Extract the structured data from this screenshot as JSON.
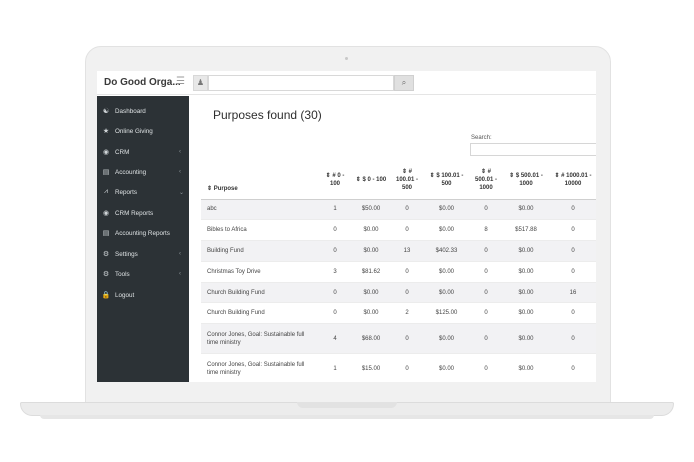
{
  "brand": {
    "name": "Do Good Orga...",
    "menu_icon": "hamburger-icon"
  },
  "topbar": {
    "user_icon": "user-icon",
    "search_icon": "search-icon",
    "search_glyph": "⌕",
    "user_glyph": "♟"
  },
  "sidebar": {
    "items": [
      {
        "label": "Dashboard",
        "icon": "dashboard-icon",
        "glyph": "☯",
        "chevron": ""
      },
      {
        "label": "Online Giving",
        "icon": "star-icon",
        "glyph": "★",
        "chevron": ""
      },
      {
        "label": "CRM",
        "icon": "user-circle-icon",
        "glyph": "◉",
        "chevron": "‹"
      },
      {
        "label": "Accounting",
        "icon": "ledger-icon",
        "glyph": "▤",
        "chevron": "‹"
      },
      {
        "label": "Reports",
        "icon": "chart-icon",
        "glyph": "⩘",
        "chevron": "⌄"
      },
      {
        "label": "CRM Reports",
        "icon": "user-circle-icon",
        "glyph": "◉",
        "chevron": ""
      },
      {
        "label": "Accounting Reports",
        "icon": "ledger-icon",
        "glyph": "▤",
        "chevron": ""
      },
      {
        "label": "Settings",
        "icon": "cogs-icon",
        "glyph": "⚙",
        "chevron": "‹"
      },
      {
        "label": "Tools",
        "icon": "cogs-icon",
        "glyph": "⚙",
        "chevron": "‹"
      },
      {
        "label": "Logout",
        "icon": "lock-icon",
        "glyph": "🔒",
        "chevron": ""
      }
    ]
  },
  "main": {
    "title": "Purposes found (30)",
    "search_label": "Search:",
    "table": {
      "headers": [
        "⇕ Purpose",
        "⇕ # 0 - 100",
        "⇕ $ 0 - 100",
        "⇕ # 100.01 - 500",
        "⇕ $ 100.01 - 500",
        "⇕ # 500.01 - 1000",
        "⇕ $ 500.01 - 1000",
        "⇕ # 1000.01 - 10000"
      ],
      "rows": [
        [
          "abc",
          "1",
          "$50.00",
          "0",
          "$0.00",
          "0",
          "$0.00",
          "0"
        ],
        [
          "Bibles to Africa",
          "0",
          "$0.00",
          "0",
          "$0.00",
          "8",
          "$517.88",
          "0"
        ],
        [
          "Building Fund",
          "0",
          "$0.00",
          "13",
          "$402.33",
          "0",
          "$0.00",
          "0"
        ],
        [
          "Christmas Toy Drive",
          "3",
          "$81.62",
          "0",
          "$0.00",
          "0",
          "$0.00",
          "0"
        ],
        [
          "Church Building Fund",
          "0",
          "$0.00",
          "0",
          "$0.00",
          "0",
          "$0.00",
          "16"
        ],
        [
          "Church Building Fund",
          "0",
          "$0.00",
          "2",
          "$125.00",
          "0",
          "$0.00",
          "0"
        ],
        [
          "Connor Jones, Goal: Sustainable full time ministry",
          "4",
          "$68.00",
          "0",
          "$0.00",
          "0",
          "$0.00",
          "0"
        ],
        [
          "Connor Jones, Goal: Sustainable full time ministry",
          "1",
          "$15.00",
          "0",
          "$0.00",
          "0",
          "$0.00",
          "0"
        ]
      ]
    }
  },
  "colors": {
    "sidebar": "#2c3236",
    "row_alt": "#f2f2f4",
    "text": "#2e2e2e"
  }
}
